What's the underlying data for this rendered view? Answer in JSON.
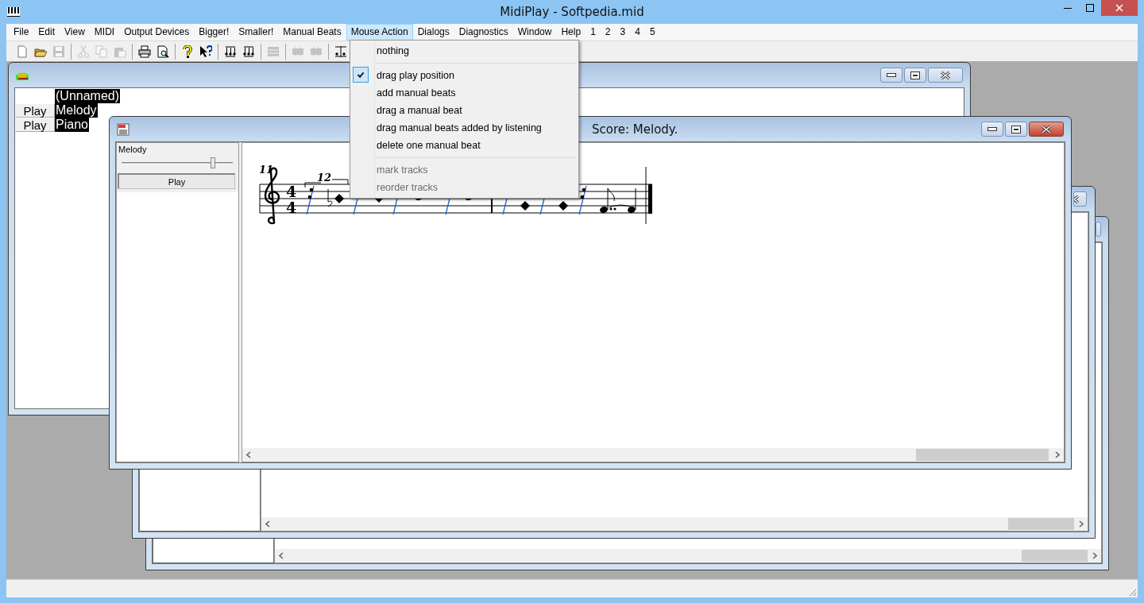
{
  "window": {
    "title": "MidiPlay - Softpedia.mid"
  },
  "menu_bar": [
    {
      "label": "File",
      "selected": false
    },
    {
      "label": "Edit",
      "selected": false
    },
    {
      "label": "View",
      "selected": false
    },
    {
      "label": "MIDI",
      "selected": false
    },
    {
      "label": "Output Devices",
      "selected": false
    },
    {
      "label": "Bigger!",
      "selected": false
    },
    {
      "label": "Smaller!",
      "selected": false
    },
    {
      "label": "Manual Beats",
      "selected": false
    },
    {
      "label": "Mouse Action",
      "selected": true
    },
    {
      "label": "Dialogs",
      "selected": false
    },
    {
      "label": "Diagnostics",
      "selected": false
    },
    {
      "label": "Window",
      "selected": false
    },
    {
      "label": "Help",
      "selected": false
    },
    {
      "label": "1",
      "selected": false
    },
    {
      "label": "2",
      "selected": false
    },
    {
      "label": "3",
      "selected": false
    },
    {
      "label": "4",
      "selected": false
    },
    {
      "label": "5",
      "selected": false
    }
  ],
  "mouse_action_menu": [
    {
      "kind": "item",
      "label": "nothing",
      "checked": false,
      "disabled": false
    },
    {
      "kind": "separator"
    },
    {
      "kind": "item",
      "label": "drag play position",
      "checked": true,
      "disabled": false
    },
    {
      "kind": "item",
      "label": "add manual beats",
      "checked": false,
      "disabled": false
    },
    {
      "kind": "item",
      "label": "drag a manual beat",
      "checked": false,
      "disabled": false
    },
    {
      "kind": "item",
      "label": "drag manual beats added by listening",
      "checked": false,
      "disabled": false
    },
    {
      "kind": "item",
      "label": "delete one manual beat",
      "checked": false,
      "disabled": false
    },
    {
      "kind": "separator"
    },
    {
      "kind": "item",
      "label": "mark tracks",
      "checked": false,
      "disabled": true
    },
    {
      "kind": "item",
      "label": "reorder tracks",
      "checked": false,
      "disabled": true
    }
  ],
  "toolbar": [
    {
      "kind": "button",
      "disabled": false
    },
    {
      "kind": "button",
      "disabled": false
    },
    {
      "kind": "button",
      "disabled": true
    },
    {
      "kind": "separator"
    },
    {
      "kind": "button",
      "disabled": true
    },
    {
      "kind": "button",
      "disabled": true
    },
    {
      "kind": "button",
      "disabled": true
    },
    {
      "kind": "separator"
    },
    {
      "kind": "button",
      "disabled": false
    },
    {
      "kind": "button",
      "disabled": false
    },
    {
      "kind": "separator"
    },
    {
      "kind": "button",
      "disabled": false
    },
    {
      "kind": "button",
      "disabled": false
    },
    {
      "kind": "separator"
    },
    {
      "kind": "button",
      "disabled": false
    },
    {
      "kind": "button",
      "disabled": false
    },
    {
      "kind": "separator"
    },
    {
      "kind": "button",
      "disabled": true
    },
    {
      "kind": "separator"
    },
    {
      "kind": "button",
      "disabled": true
    },
    {
      "kind": "button",
      "disabled": true
    },
    {
      "kind": "separator"
    },
    {
      "kind": "button",
      "disabled": false
    }
  ],
  "track_window": {
    "rows": [
      {
        "label": "(Unnamed)"
      },
      {
        "button": "Play",
        "label": "Melody"
      },
      {
        "button": "Play",
        "label": "Piano"
      }
    ]
  },
  "score_window": {
    "title": "Score: Melody.",
    "track": {
      "name": "Melody",
      "level": 0.82,
      "button": "Play"
    },
    "score": {
      "bar_numbers": [
        "11",
        "12"
      ],
      "time_signature": [
        "4",
        "4"
      ]
    }
  }
}
